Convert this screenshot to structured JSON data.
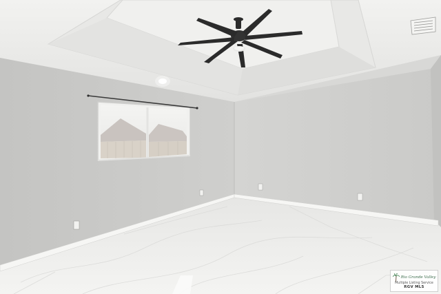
{
  "photo": {
    "subject": "empty-room",
    "accent_colors": {
      "wall_left": "#c8c8c6",
      "wall_right": "#d2d2d0",
      "ceiling": "#ececea",
      "floor": "#eeeeec",
      "baseboard": "#f4f4f2",
      "fan": "#2b2b2b"
    }
  },
  "watermark": {
    "brand": "Rio Grande Valley",
    "tagline": "Multiple Listing Service",
    "mls": "RGV MLS"
  }
}
